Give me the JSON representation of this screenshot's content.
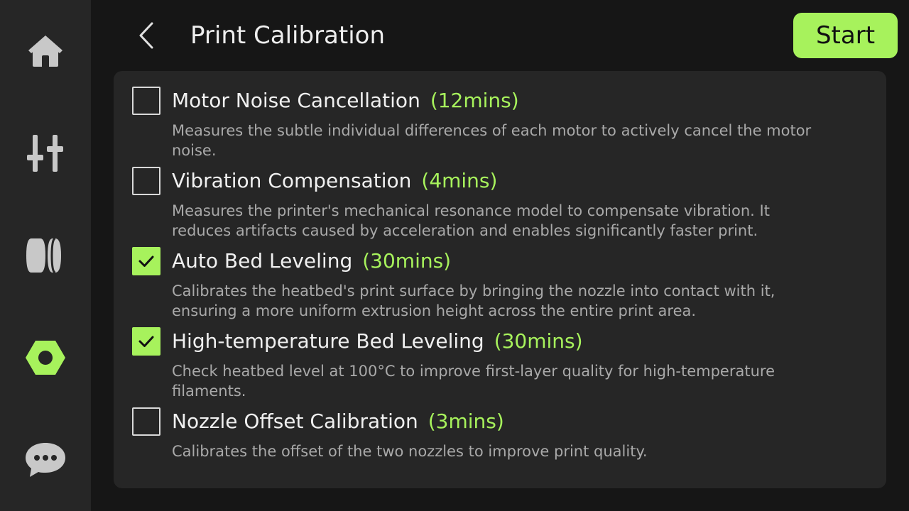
{
  "header": {
    "title": "Print Calibration",
    "start_label": "Start"
  },
  "sidebar": {
    "items": [
      {
        "icon": "home-icon",
        "active": false
      },
      {
        "icon": "sliders-icon",
        "active": false
      },
      {
        "icon": "filament-icon",
        "active": false
      },
      {
        "icon": "hex-nut-icon",
        "active": true
      },
      {
        "icon": "chat-icon",
        "active": false
      }
    ]
  },
  "calibration": {
    "items": [
      {
        "title": "Motor Noise Cancellation",
        "duration": "(12mins)",
        "checked": false,
        "description": "Measures the subtle individual differences of each motor to actively cancel the motor noise."
      },
      {
        "title": "Vibration Compensation",
        "duration": "(4mins)",
        "checked": false,
        "description": "Measures the printer's mechanical resonance model to compensate vibration. It reduces artifacts caused by acceleration and enables significantly faster print."
      },
      {
        "title": "Auto Bed Leveling",
        "duration": "(30mins)",
        "checked": true,
        "description": "Calibrates the heatbed's print surface by bringing the nozzle into contact with it, ensuring a more uniform extrusion height across the entire print area."
      },
      {
        "title": "High-temperature Bed Leveling",
        "duration": "(30mins)",
        "checked": true,
        "description": "Check heatbed level at 100°C to improve first-layer quality for high-temperature filaments."
      },
      {
        "title": "Nozzle Offset Calibration",
        "duration": "(3mins)",
        "checked": false,
        "description": "Calibrates the offset of the two nozzles to improve print quality."
      }
    ]
  },
  "colors": {
    "accent": "#a7f25c",
    "background": "#161616",
    "panel": "#262626",
    "icon_inactive": "#c8c8c8"
  }
}
